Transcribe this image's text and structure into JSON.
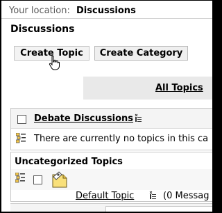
{
  "location": {
    "label": "Your location:",
    "value": "Discussions"
  },
  "page": {
    "title": "Discussions"
  },
  "toolbar": {
    "create_topic_label": "Create Topic",
    "create_category_label": "Create Category"
  },
  "all_topics": {
    "label": "All Topics"
  },
  "categories": {
    "debate": {
      "title": "Debate Discussions",
      "empty_message": "There are currently no topics in this ca"
    },
    "uncategorized": {
      "title": "Uncategorized Topics",
      "topics": [
        {
          "name": "Default Topic",
          "meta": "(0 Messag"
        }
      ]
    }
  },
  "icons": {
    "menu": "menu-lines-icon",
    "topic_list": "topic-list-icon",
    "topic": "topic-document-icon",
    "cursor": "hand-cursor-icon"
  }
}
